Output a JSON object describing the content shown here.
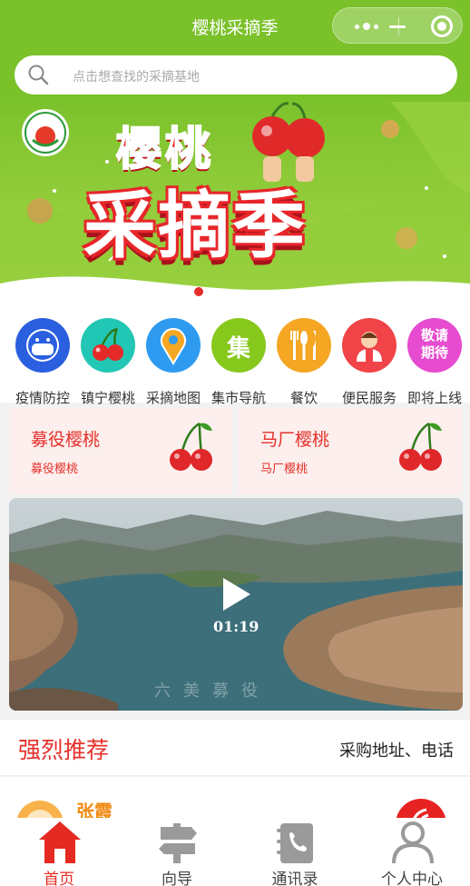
{
  "app": {
    "title": "樱桃采摘季"
  },
  "search": {
    "placeholder": "点击想查找的采摘基地"
  },
  "banner": {
    "title_top": "樱桃",
    "title_bottom": "采摘季"
  },
  "categories": [
    {
      "label": "疫情防控",
      "icon": "mask-face-icon",
      "color": "#2a5fe0"
    },
    {
      "label": "镇宁樱桃",
      "icon": "cherry-icon",
      "color": "#22c6b4"
    },
    {
      "label": "采摘地图",
      "icon": "map-pin-icon",
      "color": "#2e9bf0"
    },
    {
      "label": "集市导航",
      "icon": "market-icon",
      "color": "#86c81c",
      "glyph": "集"
    },
    {
      "label": "餐饮",
      "icon": "cutlery-icon",
      "color": "#f5a623"
    },
    {
      "label": "便民服务",
      "icon": "service-person-icon",
      "color": "#f04448"
    },
    {
      "label": "即将上线",
      "icon": "coming-soon-icon",
      "color": "#e64bd0",
      "glyph": "敬请期待"
    }
  ],
  "cards": [
    {
      "title": "募役樱桃",
      "subtitle": "募役樱桃"
    },
    {
      "title": "马厂樱桃",
      "subtitle": "马厂樱桃"
    }
  ],
  "video": {
    "duration": "01:19",
    "watermark": "六美募役"
  },
  "recommend": {
    "title": "强烈推荐",
    "right": "采购地址、电话"
  },
  "list": {
    "first_name": "张霞"
  },
  "tabbar": [
    {
      "label": "首页",
      "icon": "home-icon",
      "active": true
    },
    {
      "label": "向导",
      "icon": "signpost-icon",
      "active": false
    },
    {
      "label": "通讯录",
      "icon": "phonebook-icon",
      "active": false
    },
    {
      "label": "个人中心",
      "icon": "user-icon",
      "active": false
    }
  ],
  "colors": {
    "brand_green": "#7ac12a",
    "accent_red": "#e5302a"
  }
}
